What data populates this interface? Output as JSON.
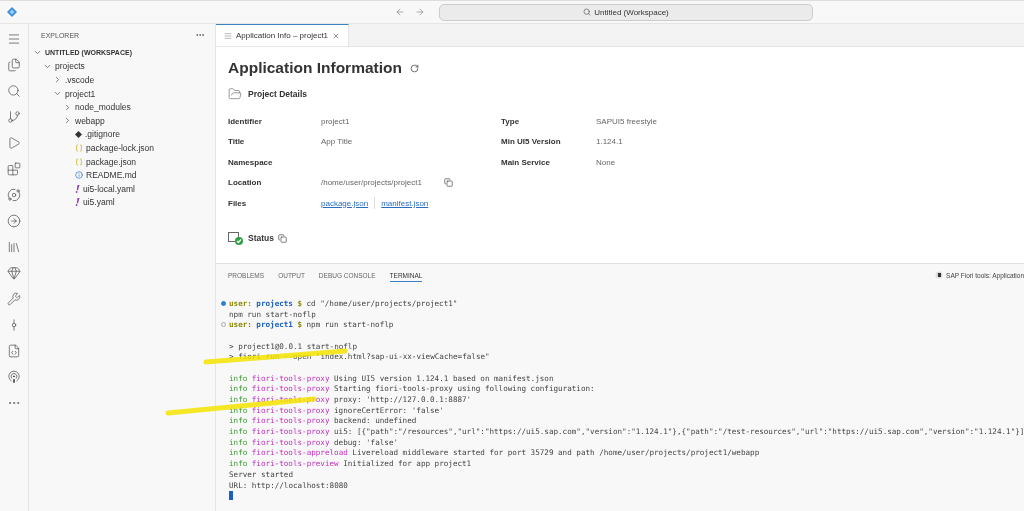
{
  "titlebar": {
    "search": "Untitled (Workspace)"
  },
  "explorer": {
    "title": "EXPLORER",
    "workspace": {
      "label": "UNTITLED (WORKSPACE)",
      "expanded": true
    },
    "tree": [
      {
        "label": "projects",
        "kind": "folder",
        "expanded": true,
        "children": [
          {
            "label": ".vscode",
            "kind": "folder",
            "expanded": false
          },
          {
            "label": "project1",
            "kind": "folder",
            "expanded": true,
            "children": [
              {
                "label": "node_modules",
                "kind": "folder",
                "expanded": false
              },
              {
                "label": "webapp",
                "kind": "folder",
                "expanded": false
              },
              {
                "label": ".gitignore",
                "kind": "git"
              },
              {
                "label": "package-lock.json",
                "kind": "json"
              },
              {
                "label": "package.json",
                "kind": "json"
              },
              {
                "label": "README.md",
                "kind": "info"
              },
              {
                "label": "ui5-local.yaml",
                "kind": "yaml"
              },
              {
                "label": "ui5.yaml",
                "kind": "yaml"
              }
            ]
          }
        ]
      }
    ]
  },
  "editor": {
    "tabs": [
      {
        "label": "Application Info – project1",
        "selected": true
      }
    ],
    "heading": "Application Information",
    "section": "Project Details",
    "left_fields": [
      {
        "label": "Identifier",
        "value": "project1"
      },
      {
        "label": "Title",
        "value": "App Title"
      },
      {
        "label": "Namespace"
      },
      {
        "label": "Location",
        "value": "/home/user/projects/project1",
        "kind": "path"
      },
      {
        "label": "Files",
        "kind": "links",
        "links": [
          "package.json",
          "manifest.json"
        ]
      }
    ],
    "right_fields": [
      {
        "label": "Type",
        "value": "SAPUI5 freestyle"
      },
      {
        "label": "Min UI5 Version",
        "value": "1.124.1"
      },
      {
        "label": "Main Service",
        "value": "None"
      }
    ],
    "status": "Status"
  },
  "panel": {
    "tabs": [
      {
        "label": "PROBLEMS",
        "selected": false
      },
      {
        "label": "OUTPUT",
        "selected": false
      },
      {
        "label": "DEBUG CONSOLE",
        "selected": false
      },
      {
        "label": "TERMINAL",
        "selected": true
      }
    ],
    "right_label": "SAP Fiori tools: Application",
    "terminal": [
      {
        "kind": "command",
        "active": true,
        "segments": [
          {
            "kind": "user",
            "text": "user:"
          },
          {
            "kind": "dir",
            "text": "projects"
          },
          {
            "kind": "user",
            "text": "$"
          },
          {
            "kind": "text",
            "text": "cd \"/home/user/projects/project1\""
          }
        ]
      },
      {
        "segments": [
          {
            "kind": "text",
            "text": "npm run start-noflp"
          }
        ]
      },
      {
        "kind": "command",
        "active": false,
        "segments": [
          {
            "kind": "user",
            "text": "user:"
          },
          {
            "kind": "dir",
            "text": "project1"
          },
          {
            "kind": "user",
            "text": "$"
          },
          {
            "kind": "text",
            "text": "npm run start-noflp"
          }
        ]
      },
      {
        "kind": "blank"
      },
      {
        "segments": [
          {
            "kind": "text",
            "text": "> project1@0.0.1 start-noflp"
          }
        ]
      },
      {
        "segments": [
          {
            "kind": "text",
            "text": "> fiori run --open \"index.html?sap-ui-xx-viewCache=false\""
          }
        ]
      },
      {
        "kind": "blank"
      },
      {
        "segments": [
          {
            "kind": "info",
            "text": "info"
          },
          {
            "kind": "source",
            "text": "fiori-tools-proxy"
          },
          {
            "kind": "text",
            "text": "Using UI5 version 1.124.1 based on manifest.json"
          }
        ]
      },
      {
        "segments": [
          {
            "kind": "info",
            "text": "info"
          },
          {
            "kind": "source",
            "text": "fiori-tools-proxy"
          },
          {
            "kind": "text",
            "text": "Starting fiori-tools-proxy using following configuration:"
          }
        ]
      },
      {
        "segments": [
          {
            "kind": "info",
            "text": "info"
          },
          {
            "kind": "source",
            "text": "fiori-tools-proxy"
          },
          {
            "kind": "text",
            "text": "proxy: 'http://127.0.0.1:8887'"
          }
        ]
      },
      {
        "segments": [
          {
            "kind": "info",
            "text": "info"
          },
          {
            "kind": "source",
            "text": "fiori-tools-proxy"
          },
          {
            "kind": "text",
            "text": "ignoreCertError: 'false'"
          }
        ]
      },
      {
        "segments": [
          {
            "kind": "info",
            "text": "info"
          },
          {
            "kind": "source",
            "text": "fiori-tools-proxy"
          },
          {
            "kind": "text",
            "text": "backend: undefined"
          }
        ]
      },
      {
        "segments": [
          {
            "kind": "info",
            "text": "info"
          },
          {
            "kind": "source",
            "text": "fiori-tools-proxy"
          },
          {
            "kind": "text",
            "text": "ui5: [{\"path\":\"/resources\",\"url\":\"https://ui5.sap.com\",\"version\":\"1.124.1\"},{\"path\":\"/test-resources\",\"url\":\"https://ui5.sap.com\",\"version\":\"1.124.1\"}]"
          }
        ]
      },
      {
        "segments": [
          {
            "kind": "info",
            "text": "info"
          },
          {
            "kind": "source",
            "text": "fiori-tools-proxy"
          },
          {
            "kind": "text",
            "text": "debug: 'false'"
          }
        ]
      },
      {
        "segments": [
          {
            "kind": "info",
            "text": "info"
          },
          {
            "kind": "source",
            "text": "fiori-tools-appreload"
          },
          {
            "kind": "text",
            "text": "Livereload middleware started for port 35729 and path /home/user/projects/project1/webapp"
          }
        ]
      },
      {
        "segments": [
          {
            "kind": "info",
            "text": "info"
          },
          {
            "kind": "source",
            "text": "fiori-tools-preview"
          },
          {
            "kind": "text",
            "text": "Initialized for app project1"
          }
        ]
      },
      {
        "segments": [
          {
            "kind": "text",
            "text": "Server started"
          }
        ]
      },
      {
        "segments": [
          {
            "kind": "text",
            "text": "URL: http://localhost:8080"
          }
        ]
      },
      {
        "kind": "cursor"
      }
    ]
  },
  "annotations": [
    {
      "kind": "highlight"
    },
    {
      "kind": "highlight"
    }
  ]
}
